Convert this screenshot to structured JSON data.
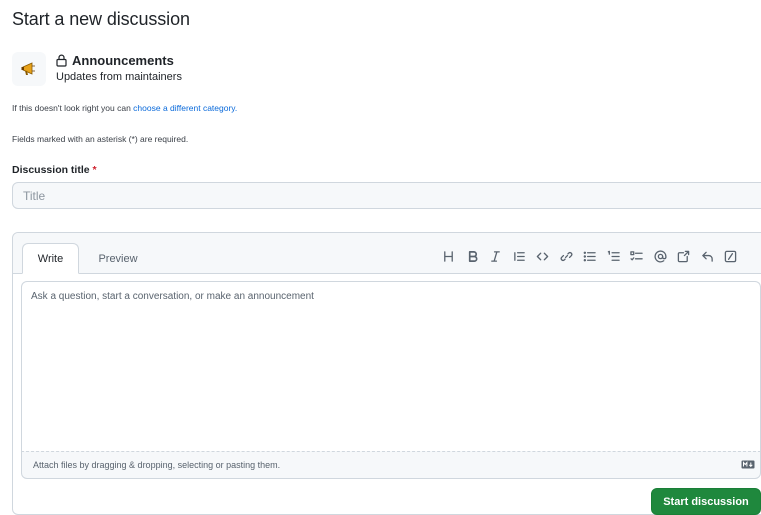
{
  "page": {
    "title": "Start a new discussion"
  },
  "category": {
    "name": "Announcements",
    "description": "Updates from maintainers",
    "change_prefix": "If this doesn't look right you can ",
    "change_link": "choose a different category."
  },
  "required_note": "Fields marked with an asterisk (*) are required.",
  "title_field": {
    "label": "Discussion title",
    "required_mark": "*",
    "placeholder": "Title",
    "value": ""
  },
  "editor": {
    "tabs": [
      {
        "label": "Write",
        "selected": true
      },
      {
        "label": "Preview",
        "selected": false
      }
    ],
    "toolbar": [
      "heading-icon",
      "bold-icon",
      "italic-icon",
      "quote-icon",
      "code-icon",
      "link-icon",
      "unordered-list-icon",
      "ordered-list-icon",
      "task-list-icon",
      "mention-icon",
      "cross-reference-icon",
      "saved-replies-icon",
      "slash-commands-icon"
    ],
    "body_placeholder": "Ask a question, start a conversation, or make an announcement",
    "body_value": "",
    "attach_text": "Attach files by dragging & dropping, selecting or pasting them."
  },
  "submit": {
    "label": "Start discussion"
  },
  "colors": {
    "accent_link": "#0969da",
    "primary_button": "#1f883d",
    "required_star": "#cf222e"
  }
}
